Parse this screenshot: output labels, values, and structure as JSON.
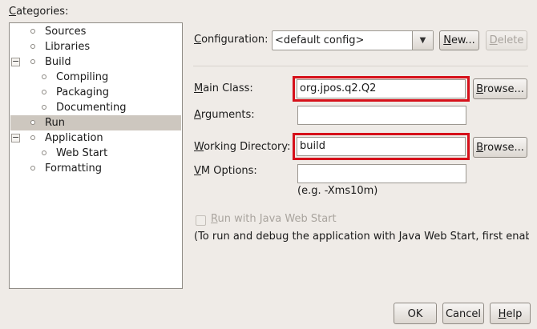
{
  "categories": {
    "label": "Categories:",
    "accel": "C",
    "label_rest": "ategories:",
    "items": [
      {
        "label": "Sources",
        "level": 1,
        "expander": "",
        "selected": false
      },
      {
        "label": "Libraries",
        "level": 1,
        "expander": "",
        "selected": false
      },
      {
        "label": "Build",
        "level": 1,
        "expander": "−",
        "selected": false
      },
      {
        "label": "Compiling",
        "level": 2,
        "expander": "",
        "selected": false
      },
      {
        "label": "Packaging",
        "level": 2,
        "expander": "",
        "selected": false
      },
      {
        "label": "Documenting",
        "level": 2,
        "expander": "",
        "selected": false
      },
      {
        "label": "Run",
        "level": 1,
        "expander": "",
        "selected": true
      },
      {
        "label": "Application",
        "level": 1,
        "expander": "−",
        "selected": false
      },
      {
        "label": "Web Start",
        "level": 2,
        "expander": "",
        "selected": false
      },
      {
        "label": "Formatting",
        "level": 1,
        "expander": "",
        "selected": false
      }
    ]
  },
  "configuration": {
    "label_accel": "C",
    "label_rest": "onfiguration:",
    "value": "<default config>",
    "new_accel": "N",
    "new_rest": "ew...",
    "delete_accel": "D",
    "delete_rest": "elete"
  },
  "main_class": {
    "label_accel": "M",
    "label_rest": "ain Class:",
    "value": "org.jpos.q2.Q2",
    "browse_accel": "B",
    "browse_rest": "rowse..."
  },
  "arguments": {
    "label_accel": "A",
    "label_rest": "rguments:",
    "value": ""
  },
  "working_directory": {
    "label_accel": "W",
    "label_rest": "orking Directory:",
    "value": "build",
    "browse_accel": "B",
    "browse_rest": "rowse..."
  },
  "vm_options": {
    "label_accel": "V",
    "label_rest": "M Options:",
    "value": "",
    "hint": "(e.g. -Xms10m)"
  },
  "web_start": {
    "label_accel": "R",
    "label_rest": "un with Java Web Start",
    "checked": false,
    "note": "(To run and debug the application with Java Web Start, first enable"
  },
  "footer": {
    "ok_label": "OK",
    "cancel_label": "Cancel",
    "help_accel": "H",
    "help_rest": "elp"
  },
  "colors": {
    "highlight": "#d6101a",
    "selection": "#cdc7bf",
    "background": "#efebe7"
  }
}
